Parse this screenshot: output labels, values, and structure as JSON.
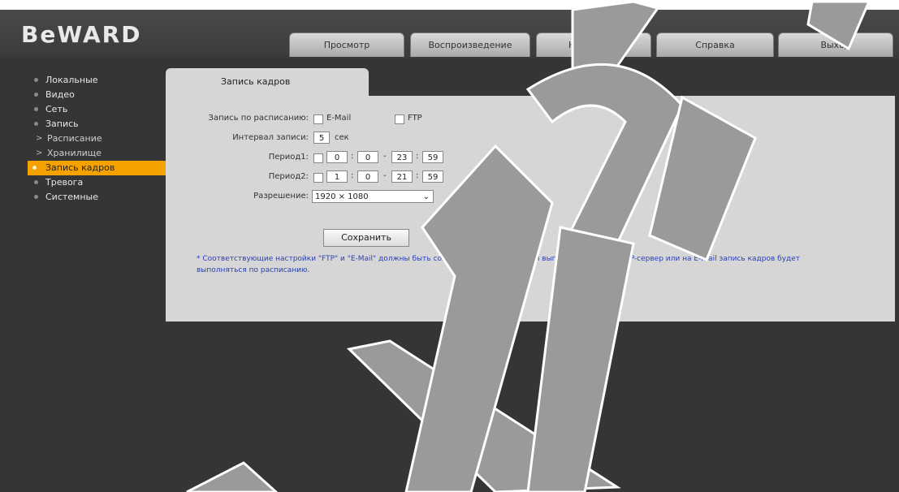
{
  "brand": {
    "logo": "BeWARD"
  },
  "tabs": [
    {
      "label": "Просмотр"
    },
    {
      "label": "Воспроизведение"
    },
    {
      "label": "Настройки"
    },
    {
      "label": "Справка"
    },
    {
      "label": "Выход"
    }
  ],
  "sidebar": {
    "items": [
      {
        "label": "Локальные"
      },
      {
        "label": "Видео"
      },
      {
        "label": "Сеть"
      },
      {
        "label": "Запись"
      },
      {
        "label": "Расписание"
      },
      {
        "label": "Хранилище"
      },
      {
        "label": "Запись кадров"
      },
      {
        "label": "Тревога"
      },
      {
        "label": "Системные"
      }
    ]
  },
  "panel": {
    "tab_title": "Запись кадров",
    "record_on_label": "Запись по расписанию:",
    "opt_email": "E-Mail",
    "opt_ftp": "FTP",
    "interval_label": "Интервал записи:",
    "interval_value": "5",
    "interval_unit": "сек",
    "period1_label": "Период1:",
    "period1": {
      "h1": "0",
      "m1": "0",
      "h2": "23",
      "m2": "59"
    },
    "period2_label": "Период2:",
    "period2": {
      "h1": "1",
      "m1": "0",
      "h2": "21",
      "m2": "59"
    },
    "resolution_label": "Разрешение:",
    "resolution_value": "1920 × 1080",
    "save_label": "Сохранить",
    "note": "* Соответствующие настройки \"FTP\" и \"E-Mail\" должны быть сохранены. При включении выгрузки кадров на FTP-сервер или на E-mail запись кадров будет выполняться по расписанию."
  },
  "colors": {
    "accent": "#f5a200",
    "background": "#353535",
    "panel": "#d6d6d6"
  }
}
